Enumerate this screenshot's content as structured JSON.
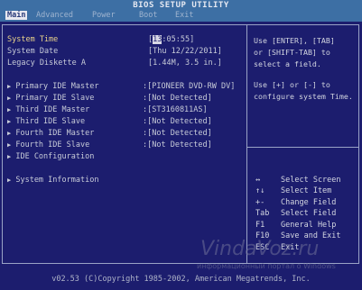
{
  "title": "BIOS SETUP UTILITY",
  "menu": [
    "Main",
    "Advanced",
    "Power",
    "Boot",
    "Exit"
  ],
  "rows": [
    {
      "label": "System Time",
      "value_prefix": "[",
      "value_cursor": "13",
      "value_rest": ":05:55]"
    },
    {
      "label": "System Date",
      "value": "[Thu 12/22/2011]"
    },
    {
      "label": "Legacy Diskette A",
      "value": "[1.44M, 3.5 in.]"
    },
    {
      "label": "Primary IDE Master",
      "value": ":[PIONEER DVD-RW  DV]"
    },
    {
      "label": "Primary IDE Slave",
      "value": ":[Not Detected]"
    },
    {
      "label": "Third IDE Master",
      "value": ":[ST3160811AS]"
    },
    {
      "label": "Third IDE Slave",
      "value": ":[Not Detected]"
    },
    {
      "label": "Fourth IDE Master",
      "value": ":[Not Detected]"
    },
    {
      "label": "Fourth IDE Slave",
      "value": ":[Not Detected]"
    },
    {
      "label": "IDE Configuration"
    },
    {
      "label": "System Information"
    }
  ],
  "help": [
    "Use [ENTER], [TAB]",
    "or [SHIFT-TAB] to",
    "select a field.",
    "Use [+] or [-] to",
    "configure system Time."
  ],
  "keys": [
    {
      "key": "↔",
      "desc": "Select Screen"
    },
    {
      "key": "↑↓",
      "desc": "Select Item"
    },
    {
      "key": "+-",
      "desc": "Change Field"
    },
    {
      "key": "Tab",
      "desc": "Select Field"
    },
    {
      "key": "F1",
      "desc": "General Help"
    },
    {
      "key": "F10",
      "desc": "Save and Exit"
    },
    {
      "key": "ESC",
      "desc": "Exit"
    }
  ],
  "watermark": "VindaVoz.ru",
  "watermark_sub": "информационный портал о Windows",
  "footer": "v02.53 (C)Copyright 1985-2002, American Megatrends, Inc."
}
